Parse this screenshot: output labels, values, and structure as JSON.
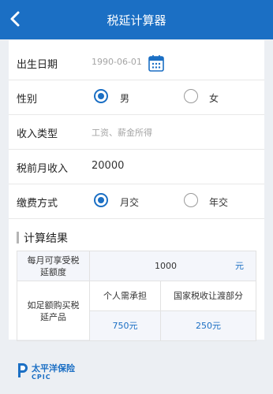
{
  "header": {
    "title": "税延计算器"
  },
  "form": {
    "birth": {
      "label": "出生日期",
      "value": "1990-06-01"
    },
    "gender": {
      "label": "性别",
      "options": [
        "男",
        "女"
      ],
      "selected": "男"
    },
    "income_type": {
      "label": "收入类型",
      "placeholder": "工资、薪金所得"
    },
    "monthly_income": {
      "label": "税前月收入",
      "value": "20000"
    },
    "payment": {
      "label": "缴费方式",
      "options": [
        "月交",
        "年交"
      ],
      "selected": "月交"
    }
  },
  "results": {
    "title": "计算结果",
    "monthly_deduction_label": "每月可享受税延额度",
    "monthly_deduction_value": "1000",
    "monthly_deduction_unit": "元",
    "purchase_label": "如足额购买税延产品",
    "personal_label": "个人需承担",
    "personal_value": "750元",
    "tax_label": "国家税收让渡部分",
    "tax_value": "250元"
  },
  "footer": {
    "brand": "太平洋保险",
    "brand_en": "CPIC"
  },
  "colors": {
    "primary": "#1b6fc4",
    "background": "#eceff3"
  },
  "icons": {
    "back": "chevron-left-icon",
    "calendar": "calendar-icon",
    "logo": "cpic-logo-icon"
  }
}
